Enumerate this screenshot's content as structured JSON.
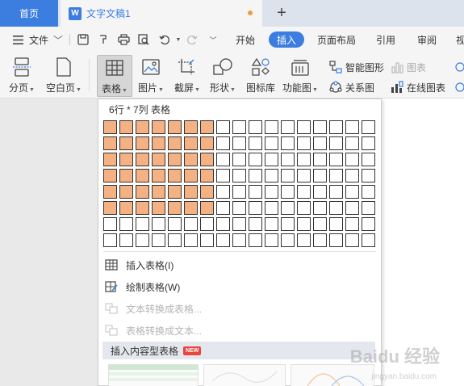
{
  "titlebar": {
    "home_tab": "首页",
    "doc_tab": "文字文稿1",
    "doc_icon": "W",
    "new_tab": "+"
  },
  "menu": {
    "file": "文件",
    "tabs": [
      "开始",
      "插入",
      "页面布局",
      "引用",
      "审阅",
      "视"
    ],
    "active_tab": "插入"
  },
  "ribbon": {
    "page_break": "分页",
    "blank_page": "空白页",
    "table": "表格",
    "picture": "图片",
    "screenshot": "截屏",
    "shapes": "形状",
    "icon_lib": "图标库",
    "func_chart": "功能图",
    "smart_art": "智能图形",
    "chart": "图表",
    "relation": "关系图",
    "online_chart": "在线图表"
  },
  "dropdown": {
    "grid_label": "6行 * 7列 表格",
    "rows": 8,
    "cols": 17,
    "selected_rows": 6,
    "selected_cols": 7,
    "options": [
      {
        "label": "插入表格(I)",
        "enabled": true
      },
      {
        "label": "绘制表格(W)",
        "enabled": true
      },
      {
        "label": "文本转换成表格...",
        "enabled": false
      },
      {
        "label": "表格转换成文本...",
        "enabled": false
      }
    ],
    "content_table": "插入内容型表格",
    "new_badge": "NEW"
  },
  "colors": {
    "accent": "#3c7ee0",
    "cell_selected": "#f4b183",
    "new_badge": "#e8453c"
  },
  "watermark": {
    "main": "Baidu 经验",
    "sub": "jingyan.baidu.com"
  }
}
